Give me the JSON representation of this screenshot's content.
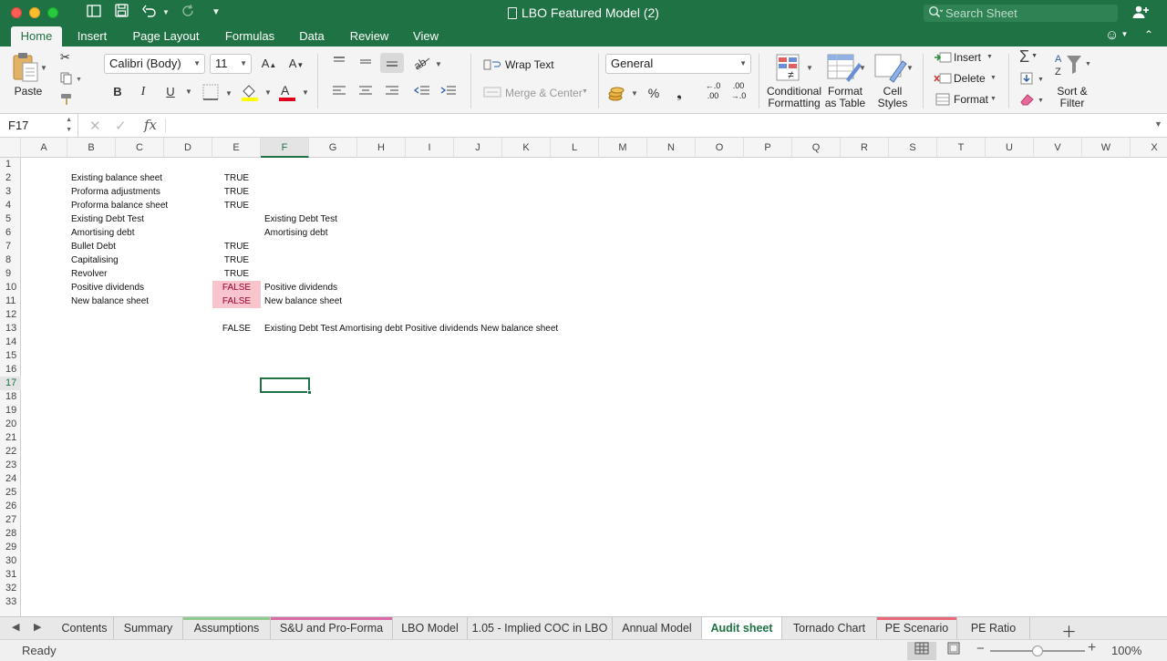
{
  "window": {
    "title": "LBO Featured Model (2)",
    "search_placeholder": "Search Sheet"
  },
  "ribbon_tabs": [
    "Home",
    "Insert",
    "Page Layout",
    "Formulas",
    "Data",
    "Review",
    "View"
  ],
  "ribbon": {
    "paste": "Paste",
    "font_name": "Calibri (Body)",
    "font_size": "11",
    "bold": "B",
    "italic": "I",
    "underline": "U",
    "wrap_text": "Wrap Text",
    "merge_center": "Merge & Center",
    "number_format": "General",
    "percent": "%",
    "comma": "❟",
    "inc_decimal_top": "←.0",
    "inc_decimal_bottom": ".00",
    "dec_decimal_top": ".00",
    "dec_decimal_bottom": "→.0",
    "conditional_formatting": [
      "Conditional",
      "Formatting"
    ],
    "format_as_table": [
      "Format",
      "as Table"
    ],
    "cell_styles": [
      "Cell",
      "Styles"
    ],
    "insert": "Insert",
    "delete": "Delete",
    "format": "Format",
    "sort_filter": [
      "Sort &",
      "Filter"
    ]
  },
  "formula_bar": {
    "name_box": "F17",
    "fx": "fx",
    "formula": ""
  },
  "columns": [
    "A",
    "B",
    "C",
    "D",
    "E",
    "F",
    "G",
    "H",
    "I",
    "J",
    "K",
    "L",
    "M",
    "N",
    "O",
    "P",
    "Q",
    "R",
    "S",
    "T",
    "U",
    "V",
    "W",
    "X"
  ],
  "active_cell": {
    "column": "F",
    "row": 17
  },
  "rows": [
    "1",
    "2",
    "3",
    "4",
    "5",
    "6",
    "7",
    "8",
    "9",
    "10",
    "11",
    "12",
    "13",
    "14",
    "15",
    "16",
    "17",
    "18",
    "19",
    "20",
    "21",
    "22",
    "23",
    "24",
    "25",
    "26",
    "27",
    "28",
    "29",
    "30",
    "31",
    "32",
    "33"
  ],
  "cells": {
    "B2": "Existing balance sheet",
    "E2": "TRUE",
    "B3": "Proforma adjustments",
    "E3": "TRUE",
    "B4": "Proforma balance sheet",
    "E4": "TRUE",
    "B5": "Existing Debt Test",
    "F5": "Existing Debt Test",
    "B6": "Amortising debt",
    "F6": "Amortising debt",
    "B7": "Bullet Debt",
    "E7": "TRUE",
    "B8": "Capitalising",
    "E8": "TRUE",
    "B9": "Revolver",
    "E9": "TRUE",
    "B10": "Positive dividends",
    "E10": "FALSE",
    "F10": "Positive dividends",
    "B11": "New balance sheet",
    "E11": "FALSE",
    "F11": "New balance sheet",
    "E13": "FALSE",
    "F13": "Existing Debt Test Amortising debt Positive dividends New balance sheet"
  },
  "highlight_color": "#f8c5cd",
  "sheet_tabs": [
    {
      "label": "Contents",
      "color": ""
    },
    {
      "label": "Summary",
      "color": ""
    },
    {
      "label": "Assumptions",
      "color": "#8fcb8f"
    },
    {
      "label": "S&U and Pro-Forma",
      "color": "#d96aa7"
    },
    {
      "label": "LBO Model",
      "color": ""
    },
    {
      "label": "1.05 - Implied COC in LBO",
      "color": ""
    },
    {
      "label": "Annual Model",
      "color": ""
    },
    {
      "label": "Audit sheet",
      "color": "",
      "active": true
    },
    {
      "label": "Tornado Chart",
      "color": ""
    },
    {
      "label": "PE Scenario",
      "color": "#e8687a"
    },
    {
      "label": "PE Ratio",
      "color": ""
    }
  ],
  "status": {
    "text": "Ready",
    "zoom": "100%",
    "zoom_fraction": 0.5
  },
  "theme": {
    "accent": "#1f7244"
  }
}
